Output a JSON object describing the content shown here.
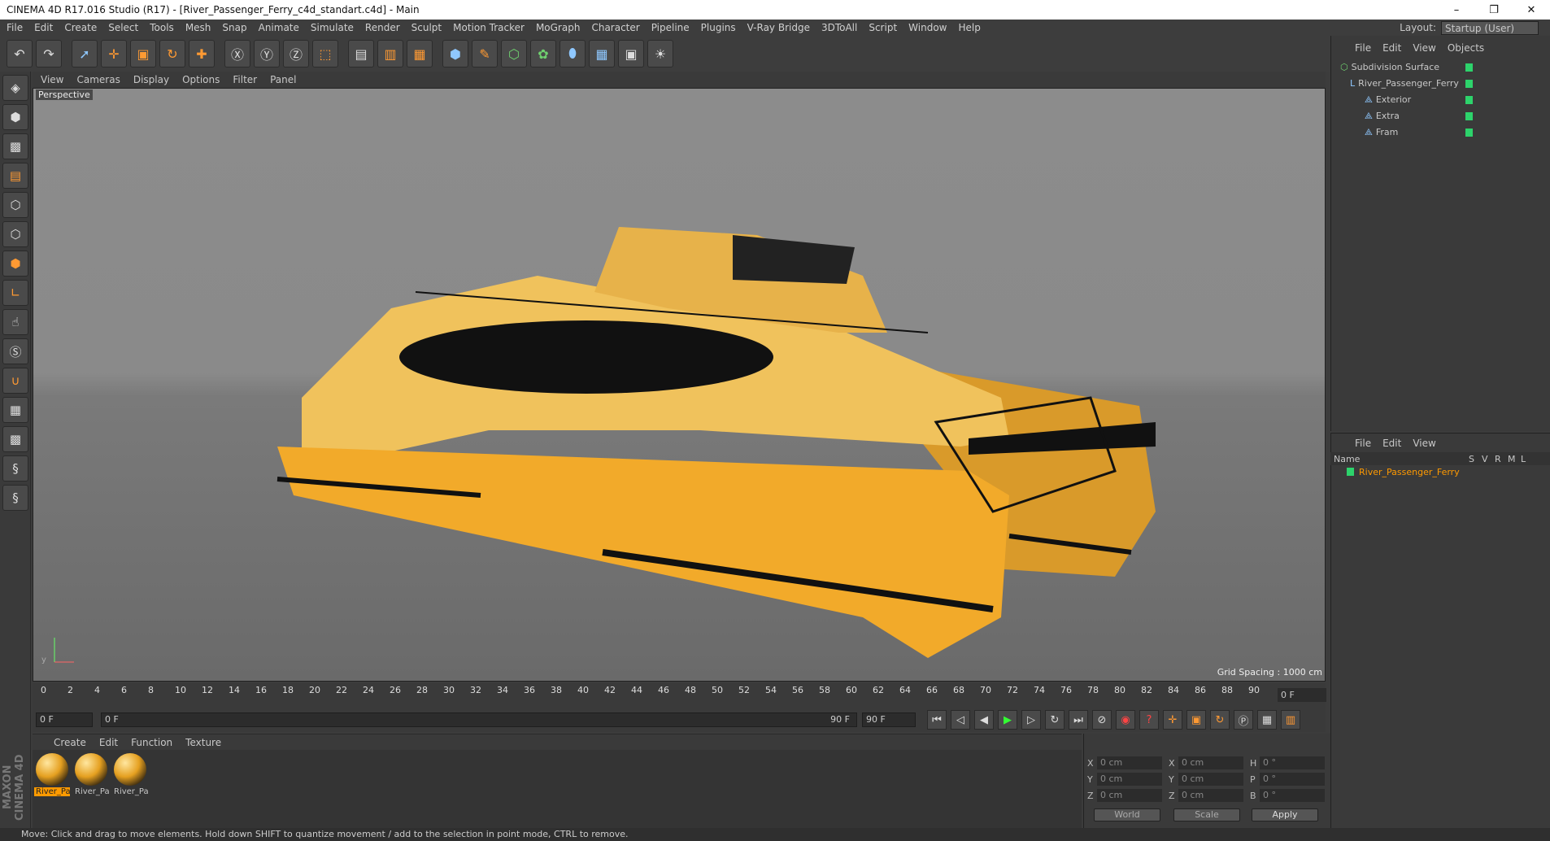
{
  "window": {
    "title": "CINEMA 4D R17.016 Studio (R17) - [River_Passenger_Ferry_c4d_standart.c4d] - Main",
    "minimize": "–",
    "maximize": "❐",
    "close": "✕"
  },
  "menu": [
    "File",
    "Edit",
    "Create",
    "Select",
    "Tools",
    "Mesh",
    "Snap",
    "Animate",
    "Simulate",
    "Render",
    "Sculpt",
    "Motion Tracker",
    "MoGraph",
    "Character",
    "Pipeline",
    "Plugins",
    "V-Ray Bridge",
    "3DToAll",
    "Script",
    "Window",
    "Help"
  ],
  "layout": {
    "label": "Layout:",
    "value": "Startup (User)"
  },
  "viewport": {
    "menu": [
      "View",
      "Cameras",
      "Display",
      "Options",
      "Filter",
      "Panel"
    ],
    "label": "Perspective",
    "grid_spacing": "Grid Spacing : 1000 cm"
  },
  "timeline": {
    "ticks": [
      "0",
      "2",
      "4",
      "6",
      "8",
      "10",
      "12",
      "14",
      "16",
      "18",
      "20",
      "22",
      "24",
      "26",
      "28",
      "30",
      "32",
      "34",
      "36",
      "38",
      "40",
      "42",
      "44",
      "46",
      "48",
      "50",
      "52",
      "54",
      "56",
      "58",
      "60",
      "62",
      "64",
      "66",
      "68",
      "70",
      "72",
      "74",
      "76",
      "78",
      "80",
      "82",
      "84",
      "86",
      "88",
      "90"
    ],
    "current": "0 F"
  },
  "playback": {
    "start": "0 F",
    "range_start": "0 F",
    "range_end": "90 F",
    "end": "90 F"
  },
  "materials": {
    "menu": [
      "Create",
      "Edit",
      "Function",
      "Texture"
    ],
    "items": [
      "River_Pa",
      "River_Pa",
      "River_Pa"
    ]
  },
  "coords": {
    "x": "0 cm",
    "y": "0 cm",
    "z": "0 cm",
    "sx": "0 cm",
    "sy": "0 cm",
    "sz": "0 cm",
    "h": "0 °",
    "p": "0 °",
    "b": "0 °",
    "mode1": "World",
    "mode2": "Scale",
    "apply": "Apply"
  },
  "objects": {
    "menu": [
      "File",
      "Edit",
      "View",
      "Objects"
    ],
    "items": [
      {
        "name": "Subdivision Surface"
      },
      {
        "name": "River_Passenger_Ferry"
      },
      {
        "name": "Exterior"
      },
      {
        "name": "Extra"
      },
      {
        "name": "Fram"
      }
    ]
  },
  "attributes": {
    "menu": [
      "File",
      "Edit",
      "View"
    ],
    "headers": {
      "name": "Name",
      "s": "S",
      "v": "V",
      "r": "R",
      "m": "M",
      "l": "L"
    },
    "row": "River_Passenger_Ferry"
  },
  "status": "Move: Click and drag to move elements. Hold down SHIFT to quantize movement / add to the selection in point mode, CTRL to remove.",
  "brand": "MAXON CINEMA 4D"
}
